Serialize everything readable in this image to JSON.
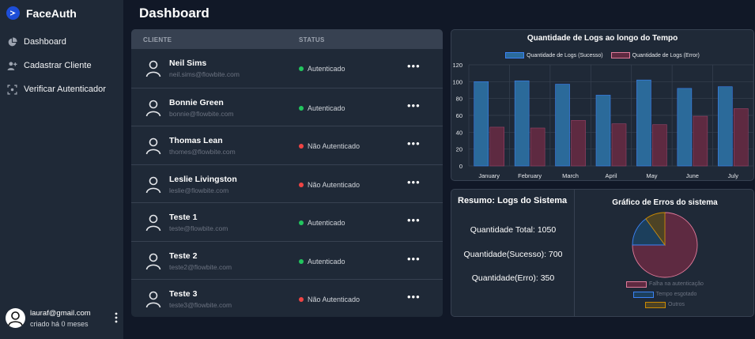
{
  "app": {
    "name": "FaceAuth"
  },
  "nav": [
    {
      "label": "Dashboard",
      "icon": "pie-chart-icon"
    },
    {
      "label": "Cadastrar Cliente",
      "icon": "add-user-icon"
    },
    {
      "label": "Verificar Autenticador",
      "icon": "face-scan-icon"
    }
  ],
  "user": {
    "email": "lauraf@gmail.com",
    "created": "criado há 0 meses"
  },
  "page": {
    "title": "Dashboard"
  },
  "table": {
    "headers": {
      "client": "CLIENTE",
      "status": "STATUS"
    },
    "rows": [
      {
        "name": "Neil Sims",
        "email": "neil.sims@flowbite.com",
        "status": "Autenticado",
        "ok": true
      },
      {
        "name": "Bonnie Green",
        "email": "bonnie@flowbite.com",
        "status": "Autenticado",
        "ok": true
      },
      {
        "name": "Thomas Lean",
        "email": "thomes@flowbite.com",
        "status": "Não Autenticado",
        "ok": false
      },
      {
        "name": "Leslie Livingston",
        "email": "leslie@flowbite.com",
        "status": "Não Autenticado",
        "ok": false
      },
      {
        "name": "Teste 1",
        "email": "teste@flowbite.com",
        "status": "Autenticado",
        "ok": true
      },
      {
        "name": "Teste 2",
        "email": "teste2@flowbite.com",
        "status": "Autenticado",
        "ok": true
      },
      {
        "name": "Teste 3",
        "email": "teste3@flowbite.com",
        "status": "Não Autenticado",
        "ok": false
      }
    ],
    "more_label": "•••"
  },
  "colors": {
    "success": "#22c55e",
    "error": "#ef4444",
    "bar_success": "#2b6a9a",
    "bar_error": "#5e2a41"
  },
  "summary": {
    "title": "Resumo: Logs do Sistema",
    "total": "Quantidade Total: 1050",
    "success": "Quantidade(Sucesso): 700",
    "error": "Quantidade(Erro): 350"
  },
  "chart_data": [
    {
      "type": "bar",
      "title": "Quantidade de Logs ao longo do Tempo",
      "categories": [
        "January",
        "February",
        "March",
        "April",
        "May",
        "June",
        "July"
      ],
      "series": [
        {
          "name": "Quantidade de Logs (Sucesso)",
          "values": [
            100,
            101,
            97,
            84,
            102,
            92,
            94
          ],
          "color": "#2b6a9a"
        },
        {
          "name": "Quantidade de Logs (Error)",
          "values": [
            46,
            45,
            54,
            50,
            49,
            59,
            68
          ],
          "color": "#5e2a41"
        }
      ],
      "yticks": [
        "0",
        "20",
        "40",
        "60",
        "80",
        "100",
        "120"
      ],
      "ylim": [
        0,
        120
      ],
      "grid": true,
      "legend": "top"
    },
    {
      "type": "pie",
      "title": "Gráfico de Erros do sistema",
      "labels": [
        "Falha na autenticação",
        "Tempo esgotado",
        "Outros"
      ],
      "values": [
        75,
        15,
        10
      ],
      "colors": [
        "#5e2a41",
        "#1c3f5c",
        "#4d4325"
      ],
      "borders": [
        "#e07a9a",
        "#3b82f6",
        "#ca8a04"
      ],
      "legend": "bottom"
    }
  ]
}
